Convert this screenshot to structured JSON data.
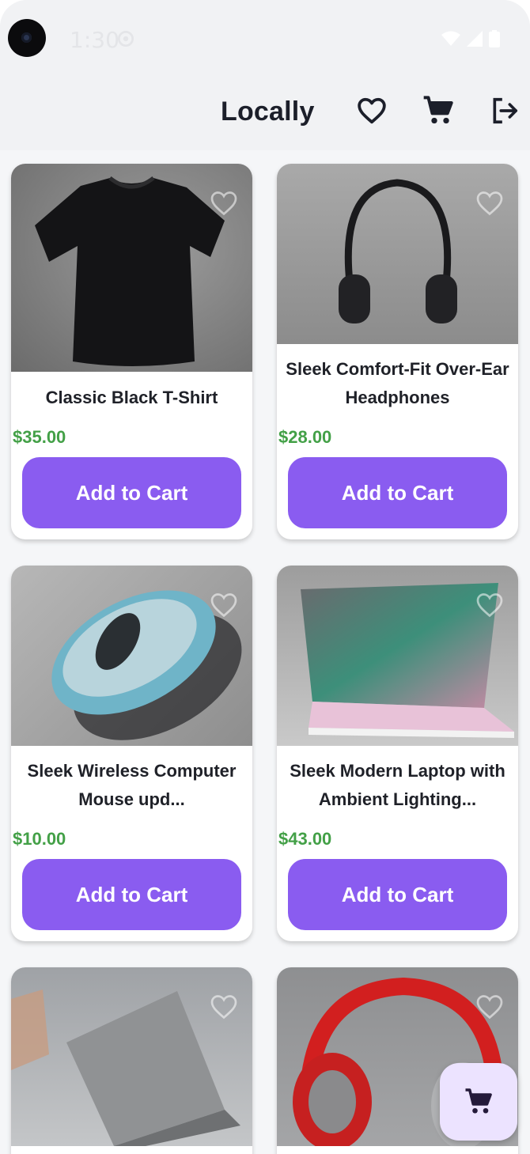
{
  "status_bar": {
    "time": "1:30"
  },
  "app_bar": {
    "title": "Locally",
    "icons": [
      "heart-outline-icon",
      "cart-icon",
      "logout-icon"
    ]
  },
  "products": [
    {
      "title": "Classic Black T-Shirt",
      "price": "$35.00",
      "button": "Add to Cart"
    },
    {
      "title": "Sleek Comfort-Fit Over-Ear Headphones",
      "price": "$28.00",
      "button": "Add to Cart"
    },
    {
      "title": "Sleek Wireless Computer Mouse upd...",
      "price": "$10.00",
      "button": "Add to Cart"
    },
    {
      "title": "Sleek Modern Laptop with Ambient Lighting...",
      "price": "$43.00",
      "button": "Add to Cart"
    }
  ],
  "colors": {
    "accent": "#8a5cf0",
    "price": "#43a047",
    "fab_bg": "#ece3ff",
    "title": "#1c1f2a"
  }
}
